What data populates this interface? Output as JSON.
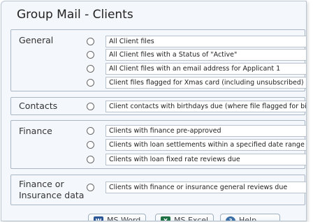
{
  "window": {
    "title": "Group Mail - Clients"
  },
  "groups": [
    {
      "label": "General",
      "options": [
        "All Client files",
        "All Client files with a Status of \"Active\"",
        "All Client files with an email address for Applicant 1",
        "Client files flagged for Xmas card (including unsubscribed)"
      ]
    },
    {
      "label": "Contacts",
      "options": [
        "Client contacts with birthdays due (where file flagged for birthday card)"
      ]
    },
    {
      "label": "Finance",
      "options": [
        "Clients with finance pre-approved",
        "Clients with loan settlements within a specified date range",
        "Clients with loan fixed rate reviews due"
      ]
    },
    {
      "label_line1": "Finance or",
      "label_line2": "Insurance data",
      "options": [
        "Clients with finance or insurance general reviews due"
      ]
    }
  ],
  "buttons": {
    "word": "MS Word",
    "excel": "MS Excel",
    "help": "Help"
  },
  "colors": {
    "word_icon": "#2b5797",
    "excel_icon": "#1e7145",
    "help_icon": "#3a6ea5"
  }
}
